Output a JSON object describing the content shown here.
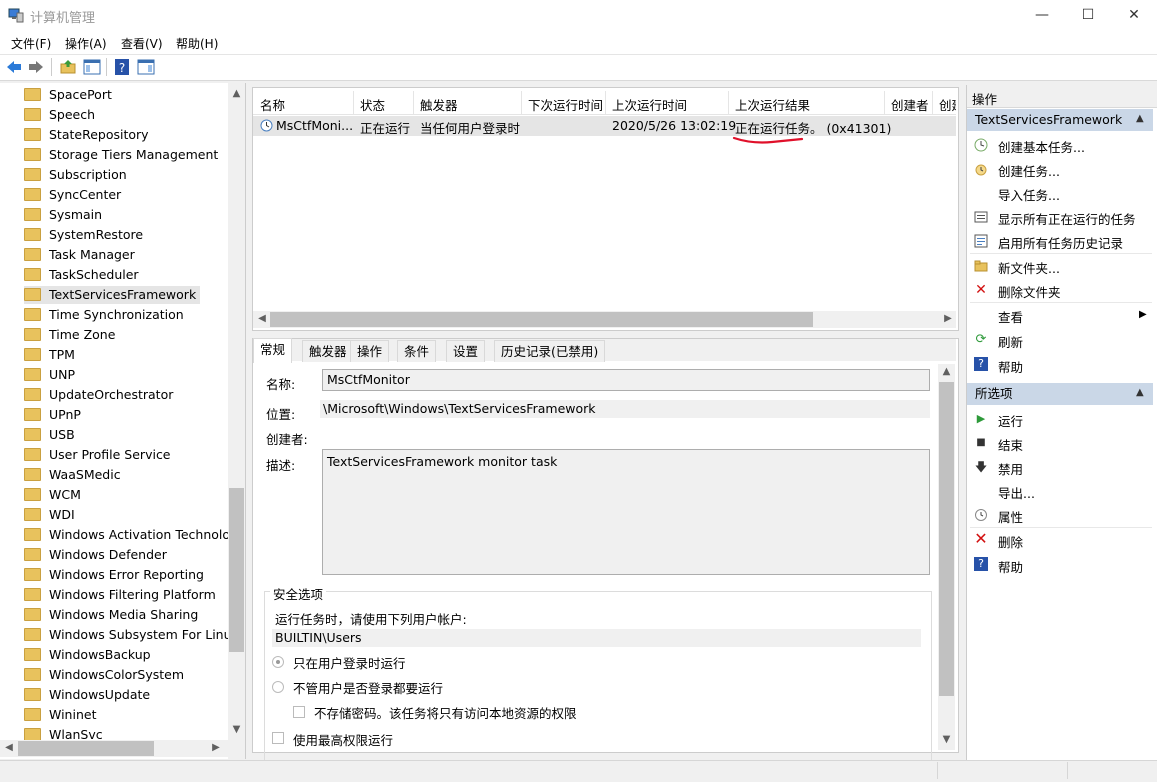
{
  "window": {
    "title": "计算机管理",
    "minimize_glyph": "—",
    "maximize_glyph": "☐",
    "close_glyph": "✕"
  },
  "menu": [
    "文件(F)",
    "操作(A)",
    "查看(V)",
    "帮助(H)"
  ],
  "tree": {
    "items": [
      "SpacePort",
      "Speech",
      "StateRepository",
      "Storage Tiers Management",
      "Subscription",
      "SyncCenter",
      "Sysmain",
      "SystemRestore",
      "Task Manager",
      "TaskScheduler",
      "TextServicesFramework",
      "Time Synchronization",
      "Time Zone",
      "TPM",
      "UNP",
      "UpdateOrchestrator",
      "UPnP",
      "USB",
      "User Profile Service",
      "WaaSMedic",
      "WCM",
      "WDI",
      "Windows Activation Technolog",
      "Windows Defender",
      "Windows Error Reporting",
      "Windows Filtering Platform",
      "Windows Media Sharing",
      "Windows Subsystem For Linux",
      "WindowsBackup",
      "WindowsColorSystem",
      "WindowsUpdate",
      "Wininet",
      "WlanSvc"
    ],
    "selected": "TextServicesFramework"
  },
  "task_list": {
    "columns": [
      "名称",
      "状态",
      "触发器",
      "下次运行时间",
      "上次运行时间",
      "上次运行结果",
      "创建者",
      "创建"
    ],
    "row": {
      "name": "MsCtfMoni...",
      "status": "正在运行",
      "trigger": "当任何用户登录时",
      "next_run": "",
      "last_run": "2020/5/26 13:02:19",
      "last_result": "正在运行任务。 (0x41301)"
    }
  },
  "details": {
    "tabs": [
      "常规",
      "触发器",
      "操作",
      "条件",
      "设置",
      "历史记录(已禁用)"
    ],
    "name_label": "名称:",
    "name_value": "MsCtfMonitor",
    "location_label": "位置:",
    "location_value": "\\Microsoft\\Windows\\TextServicesFramework",
    "author_label": "创建者:",
    "desc_label": "描述:",
    "desc_value": "TextServicesFramework monitor task",
    "security_title": "安全选项",
    "run_as_text": "运行任务时，请使用下列用户帐户:",
    "run_as_value": "BUILTIN\\Users",
    "radio_logged_on": "只在用户登录时运行",
    "radio_always": "不管用户是否登录都要运行",
    "no_store_password": "不存储密码。该任务将只有访问本地资源的权限",
    "highest_privileges": "使用最高权限运行"
  },
  "actions": {
    "title": "操作",
    "section1": "TextServicesFramework",
    "items1": [
      "创建基本任务...",
      "创建任务...",
      "导入任务...",
      "显示所有正在运行的任务",
      "启用所有任务历史记录",
      "新文件夹...",
      "删除文件夹",
      "查看",
      "刷新",
      "帮助"
    ],
    "section2": "所选项",
    "items2": [
      "运行",
      "结束",
      "禁用",
      "导出...",
      "属性",
      "删除",
      "帮助"
    ]
  },
  "colors": {
    "selection": "#e5e5e5",
    "section_header": "#cad7e7",
    "underline_annotation": "#e0102a"
  }
}
